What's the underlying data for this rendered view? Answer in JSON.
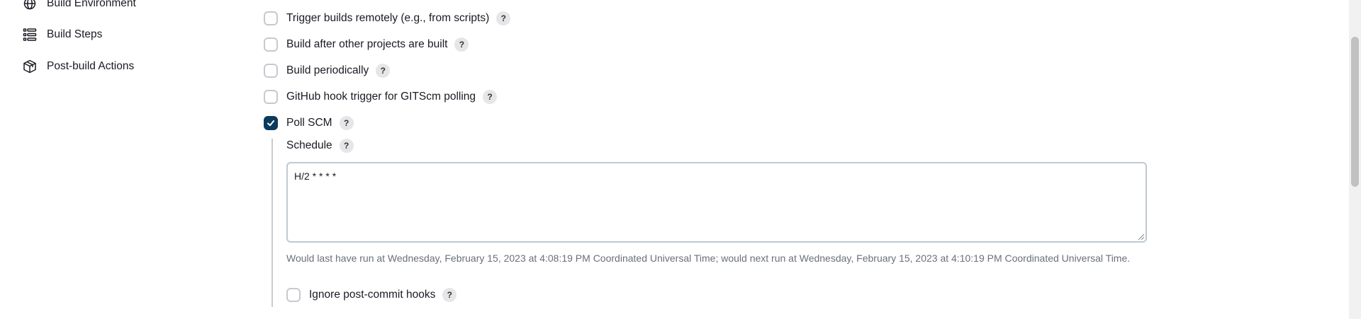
{
  "sidebar": {
    "items": [
      {
        "label": "Build Environment",
        "icon": "globe-icon"
      },
      {
        "label": "Build Steps",
        "icon": "list-icon"
      },
      {
        "label": "Post-build Actions",
        "icon": "cube-icon"
      }
    ]
  },
  "triggers": {
    "remote": {
      "label": "Trigger builds remotely (e.g., from scripts)",
      "checked": false
    },
    "after_other": {
      "label": "Build after other projects are built",
      "checked": false
    },
    "periodically": {
      "label": "Build periodically",
      "checked": false
    },
    "github_hook": {
      "label": "GitHub hook trigger for GITScm polling",
      "checked": false
    },
    "poll_scm": {
      "label": "Poll SCM",
      "checked": true
    }
  },
  "help_label": "?",
  "schedule": {
    "label": "Schedule",
    "value": "H/2 * * * *",
    "info": "Would last have run at Wednesday, February 15, 2023 at 4:08:19 PM Coordinated Universal Time; would next run at Wednesday, February 15, 2023 at 4:10:19 PM Coordinated Universal Time."
  },
  "ignore_post_commit": {
    "label": "Ignore post-commit hooks",
    "checked": false
  },
  "colors": {
    "accent": "#0b3a5c",
    "border": "#c7c9cf",
    "muted_text": "#6b6f7b"
  }
}
